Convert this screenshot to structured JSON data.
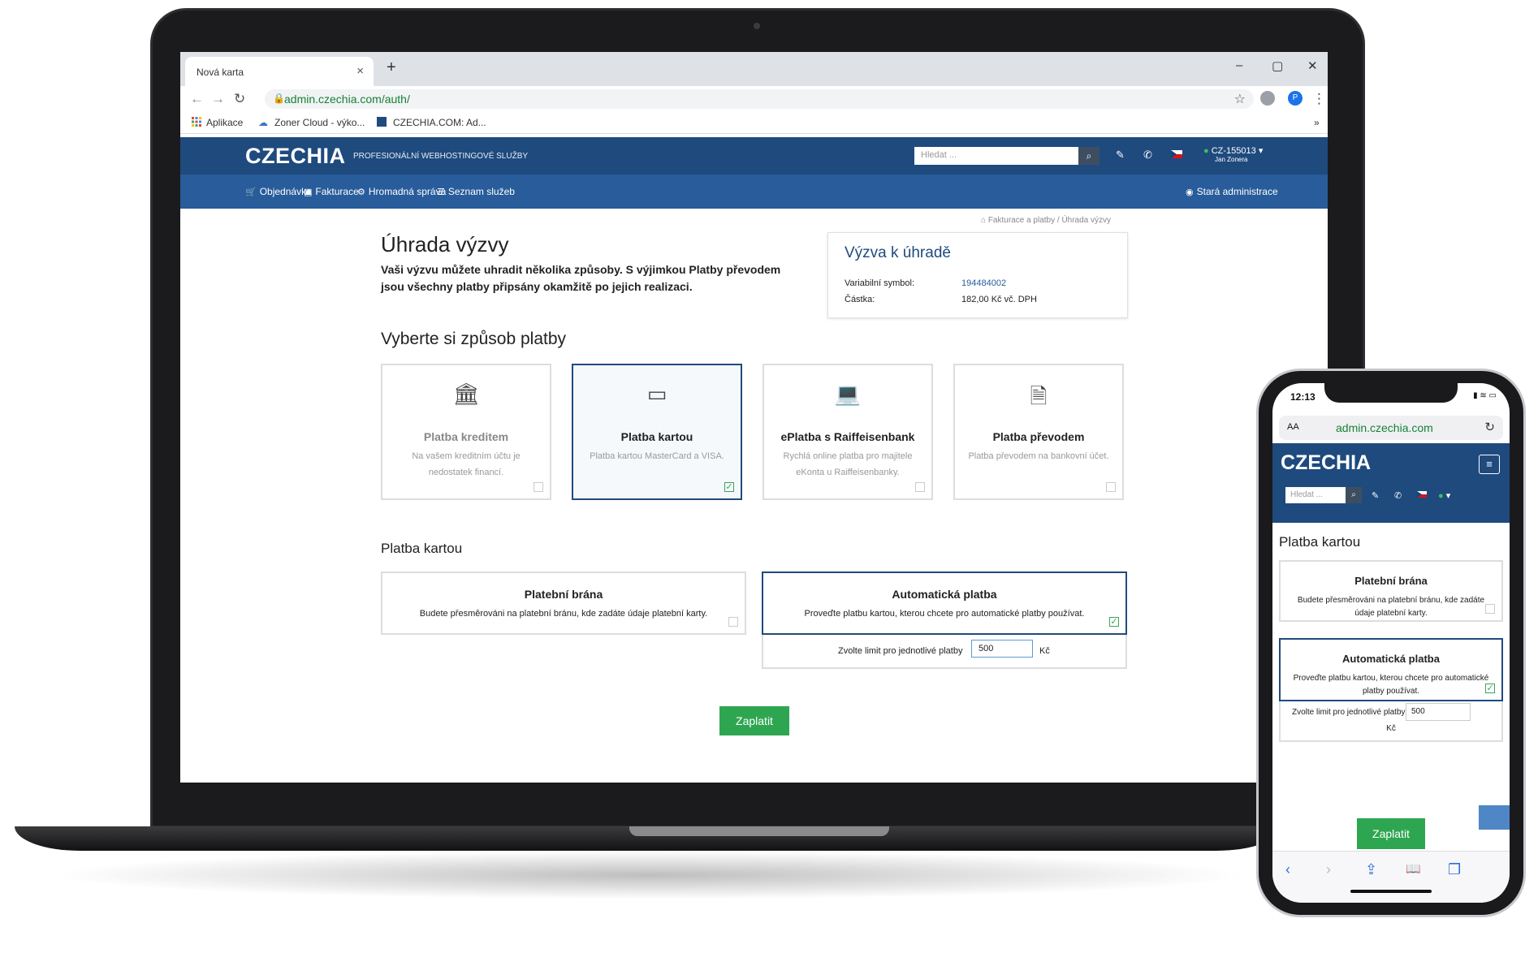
{
  "browser": {
    "tab_title": "Nová karta",
    "tab_close": "×",
    "new_tab": "+",
    "win_min": "–",
    "win_max": "▢",
    "win_close": "✕",
    "back": "←",
    "forward": "→",
    "reload": "↻",
    "url": "admin.czechia.com/auth/",
    "star": "☆",
    "menu": "⋮",
    "profile": "P",
    "bookmarks": [
      "Aplikace",
      "Zoner Cloud - výko...",
      "CZECHIA.COM: Ad..."
    ],
    "bookmarks_more": "»"
  },
  "header": {
    "logo": "CZECHIA",
    "tagline": "PROFESIONÁLNÍ WEBHOSTINGOVÉ SLUŽBY",
    "search_placeholder": "Hledat ...",
    "account_id": "CZ-155013",
    "account_name": "Jan Zonera"
  },
  "nav": {
    "items": [
      "Objednávka",
      "Fakturace",
      "Hromadná správa",
      "Seznam služeb"
    ],
    "old_admin": "Stará administrace"
  },
  "breadcrumb": {
    "parent": "Fakturace a platby",
    "separator": "/",
    "current": "Úhrada výzvy"
  },
  "main": {
    "title": "Úhrada výzvy",
    "lead": "Vaši výzvu můžete uhradit několika způsoby. S výjimkou Platby převodem jsou všechny platby připsány okamžitě po jejich realizaci.",
    "invoice": {
      "title": "Výzva k úhradě",
      "var_symbol_label": "Variabilní symbol:",
      "var_symbol": "194484002",
      "amount_label": "Částka:",
      "amount": "182,00 Kč vč. DPH"
    },
    "method_heading": "Vyberte si způsob platby",
    "methods": [
      {
        "title": "Platba kreditem",
        "desc": "Na vašem kreditním účtu je nedostatek financí."
      },
      {
        "title": "Platba kartou",
        "desc": "Platba kartou MasterCard a VISA."
      },
      {
        "title": "ePlatba s Raiffeisenbank",
        "desc": "Rychlá online platba pro majitele eKonta u Raiffeisenbanky."
      },
      {
        "title": "Platba převodem",
        "desc": "Platba převodem na bankovní účet."
      }
    ],
    "card_heading": "Platba kartou",
    "card_options": [
      {
        "title": "Platební brána",
        "desc": "Budete přesměrováni na platební bránu, kde zadáte údaje platební karty."
      },
      {
        "title": "Automatická platba",
        "desc": "Proveďte platbu kartou, kterou chcete pro automatické platby používat."
      }
    ],
    "limit_label": "Zvolte limit pro jednotlivé platby",
    "limit_value": "500",
    "limit_unit": "Kč",
    "pay_button": "Zaplatit"
  },
  "phone": {
    "time": "12:13",
    "status": "▮ ≋ ▭",
    "aa": "AA",
    "url": "admin.czechia.com",
    "reload": "↻",
    "logo": "CZECHIA",
    "menu": "≡",
    "search_placeholder": "Hledat ...",
    "heading": "Platba kartou",
    "options": [
      {
        "title": "Platební brána",
        "desc": "Budete přesměrováni na platební bránu, kde zadáte údaje platební karty."
      },
      {
        "title": "Automatická platba",
        "desc": "Proveďte platbu kartou, kterou chcete pro automatické platby používat."
      }
    ],
    "limit_label": "Zvolte limit pro jednotlivé platby",
    "limit_value": "500",
    "limit_unit": "Kč",
    "pay_button": "Zaplatit",
    "bar": [
      "‹",
      "›",
      "⇪",
      "📖",
      "❐"
    ]
  },
  "colors": {
    "header": "#1f4a7e",
    "nav": "#285c9b",
    "pay": "#2ea651",
    "selected_border": "#1f4a7e"
  }
}
